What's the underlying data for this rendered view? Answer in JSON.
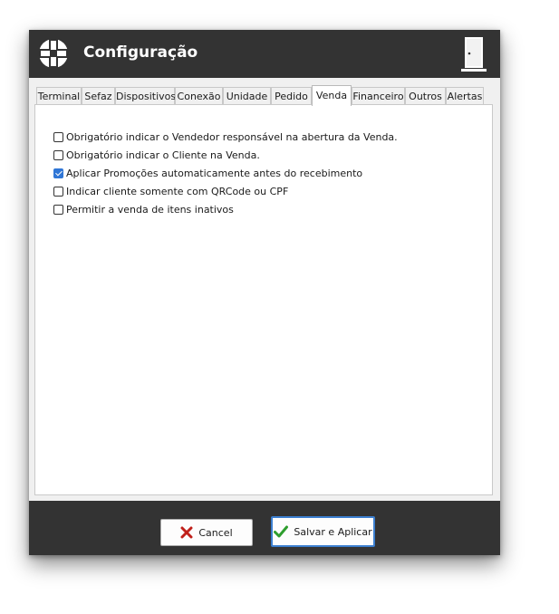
{
  "window": {
    "title": "Configuração",
    "logo_icon": "chain-logo-icon",
    "exit_icon": "exit-door-icon"
  },
  "tabs": [
    {
      "label": "Terminal",
      "active": false
    },
    {
      "label": "Sefaz",
      "active": false
    },
    {
      "label": "Dispositivos",
      "active": false
    },
    {
      "label": "Conexão",
      "active": false
    },
    {
      "label": "Unidade",
      "active": false
    },
    {
      "label": "Pedido",
      "active": false
    },
    {
      "label": "Venda",
      "active": true
    },
    {
      "label": "Financeiro",
      "active": false
    },
    {
      "label": "Outros",
      "active": false
    },
    {
      "label": "Alertas",
      "active": false
    }
  ],
  "options": [
    {
      "label": "Obrigatório indicar o Vendedor responsável na abertura da Venda.",
      "checked": false
    },
    {
      "label": "Obrigatório indicar o Cliente na Venda.",
      "checked": false
    },
    {
      "label": "Aplicar Promoções automaticamente antes do recebimento",
      "checked": true
    },
    {
      "label": "Indicar cliente somente com QRCode ou CPF",
      "checked": false
    },
    {
      "label": "Permitir a venda de itens inativos",
      "checked": false
    }
  ],
  "buttons": {
    "cancel_label": "Cancel",
    "save_label": "Salvar e Aplicar"
  },
  "colors": {
    "titlebar": "#333333",
    "checkbox_checked": "#2f76d6",
    "cancel_icon": "#c0201a",
    "save_icon": "#2e9e2e"
  }
}
